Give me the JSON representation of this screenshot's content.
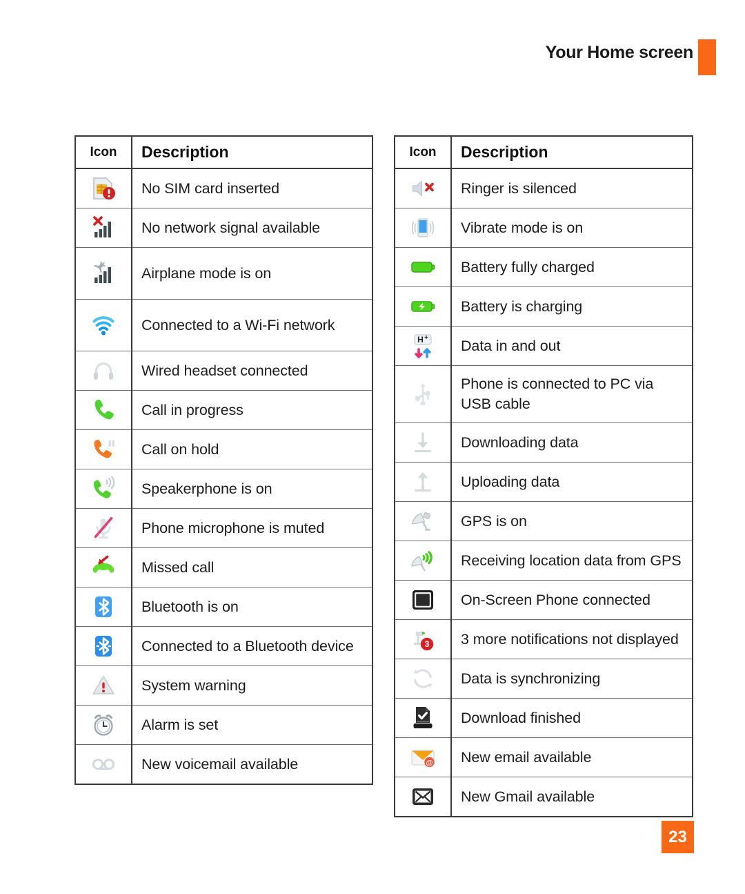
{
  "header": {
    "title": "Your Home screen",
    "accent_color": "#f96815"
  },
  "page_number": "23",
  "tables": [
    {
      "id": "left",
      "columns": {
        "icon": "Icon",
        "description": "Description"
      },
      "rows": [
        {
          "icon": "sim-card-error-icon",
          "description": "No SIM card inserted"
        },
        {
          "icon": "no-signal-icon",
          "description": "No network signal available"
        },
        {
          "icon": "airplane-mode-icon",
          "description": "Airplane mode is on"
        },
        {
          "icon": "wifi-icon",
          "description": "Connected to a Wi-Fi network"
        },
        {
          "icon": "headset-icon",
          "description": "Wired headset connected"
        },
        {
          "icon": "call-in-progress-icon",
          "description": "Call in progress"
        },
        {
          "icon": "call-on-hold-icon",
          "description": "Call on hold"
        },
        {
          "icon": "speakerphone-icon",
          "description": "Speakerphone is on"
        },
        {
          "icon": "microphone-muted-icon",
          "description": "Phone microphone is muted"
        },
        {
          "icon": "missed-call-icon",
          "description": "Missed call"
        },
        {
          "icon": "bluetooth-on-icon",
          "description": "Bluetooth is on"
        },
        {
          "icon": "bluetooth-connected-icon",
          "description": "Connected to a Bluetooth device"
        },
        {
          "icon": "system-warning-icon",
          "description": "System warning"
        },
        {
          "icon": "alarm-clock-icon",
          "description": "Alarm is set"
        },
        {
          "icon": "voicemail-icon",
          "description": "New voicemail available"
        }
      ]
    },
    {
      "id": "right",
      "columns": {
        "icon": "Icon",
        "description": "Description"
      },
      "rows": [
        {
          "icon": "ringer-silenced-icon",
          "description": "Ringer is silenced"
        },
        {
          "icon": "vibrate-mode-icon",
          "description": "Vibrate mode is on"
        },
        {
          "icon": "battery-full-icon",
          "description": "Battery fully charged"
        },
        {
          "icon": "battery-charging-icon",
          "description": "Battery is charging"
        },
        {
          "icon": "data-in-out-icon",
          "description": "Data in and out"
        },
        {
          "icon": "usb-connected-icon",
          "description": "Phone is connected to PC via USB cable"
        },
        {
          "icon": "download-data-icon",
          "description": "Downloading data"
        },
        {
          "icon": "upload-data-icon",
          "description": "Uploading data"
        },
        {
          "icon": "gps-on-icon",
          "description": "GPS is on"
        },
        {
          "icon": "gps-receiving-icon",
          "description": "Receiving location data from GPS"
        },
        {
          "icon": "on-screen-phone-icon",
          "description": "On-Screen Phone connected"
        },
        {
          "icon": "more-notifications-icon",
          "description": "3 more notifications not displayed"
        },
        {
          "icon": "sync-icon",
          "description": "Data is synchronizing"
        },
        {
          "icon": "download-finished-icon",
          "description": "Download finished"
        },
        {
          "icon": "new-email-icon",
          "description": "New email available"
        },
        {
          "icon": "new-gmail-icon",
          "description": "New Gmail available"
        }
      ]
    }
  ]
}
